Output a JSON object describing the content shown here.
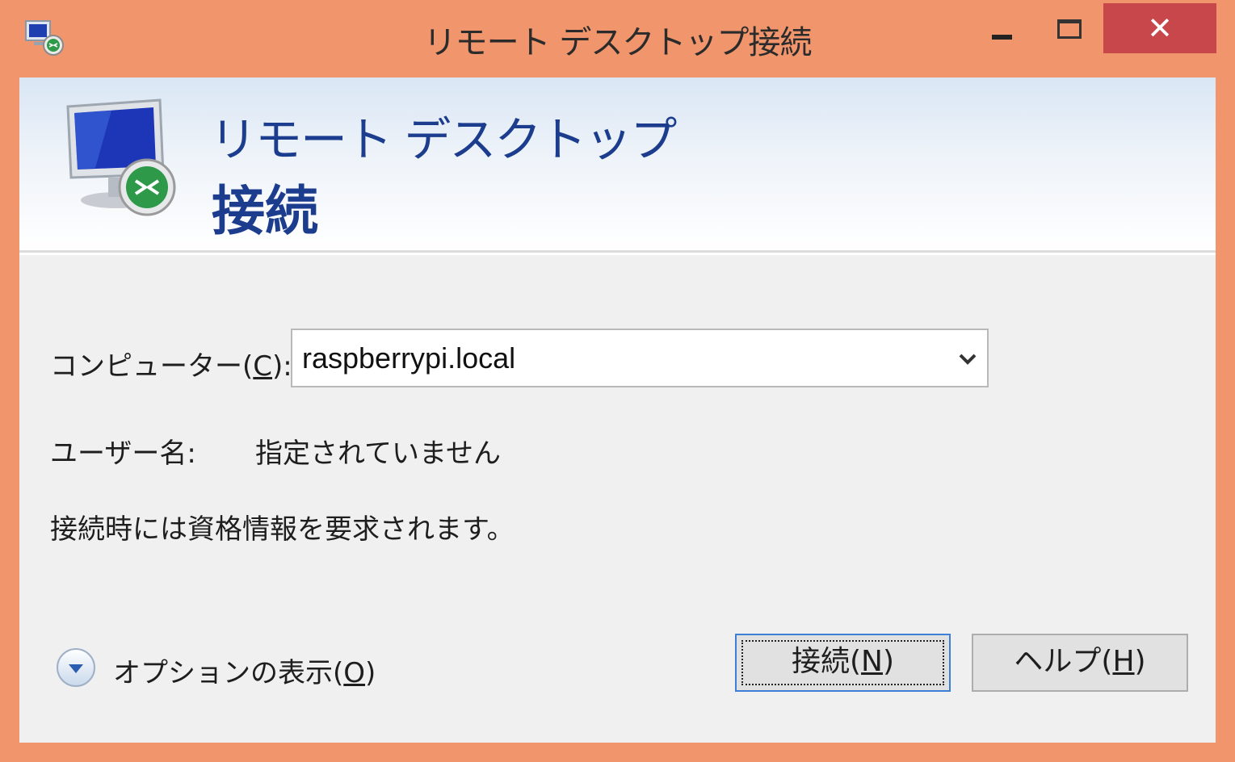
{
  "window": {
    "title": "リモート デスクトップ接続",
    "close_glyph": "✕",
    "accent_color": "#f0956c",
    "close_color": "#c7474a"
  },
  "header": {
    "title_line1": "リモート デスクトップ",
    "title_line2": "接続"
  },
  "form": {
    "computer_label_pre": "コンピューター(",
    "computer_label_key": "C",
    "computer_label_post": "):",
    "computer_value": "raspberrypi.local",
    "user_label": "ユーザー名:",
    "user_value": "指定されていません",
    "credentials_message": "接続時には資格情報を要求されます。"
  },
  "footer": {
    "options_pre": "オプションの表示(",
    "options_key": "O",
    "options_post": ")",
    "connect_pre": "接続(",
    "connect_key": "N",
    "connect_post": ")",
    "help_pre": "ヘルプ(",
    "help_key": "H",
    "help_post": ")"
  }
}
